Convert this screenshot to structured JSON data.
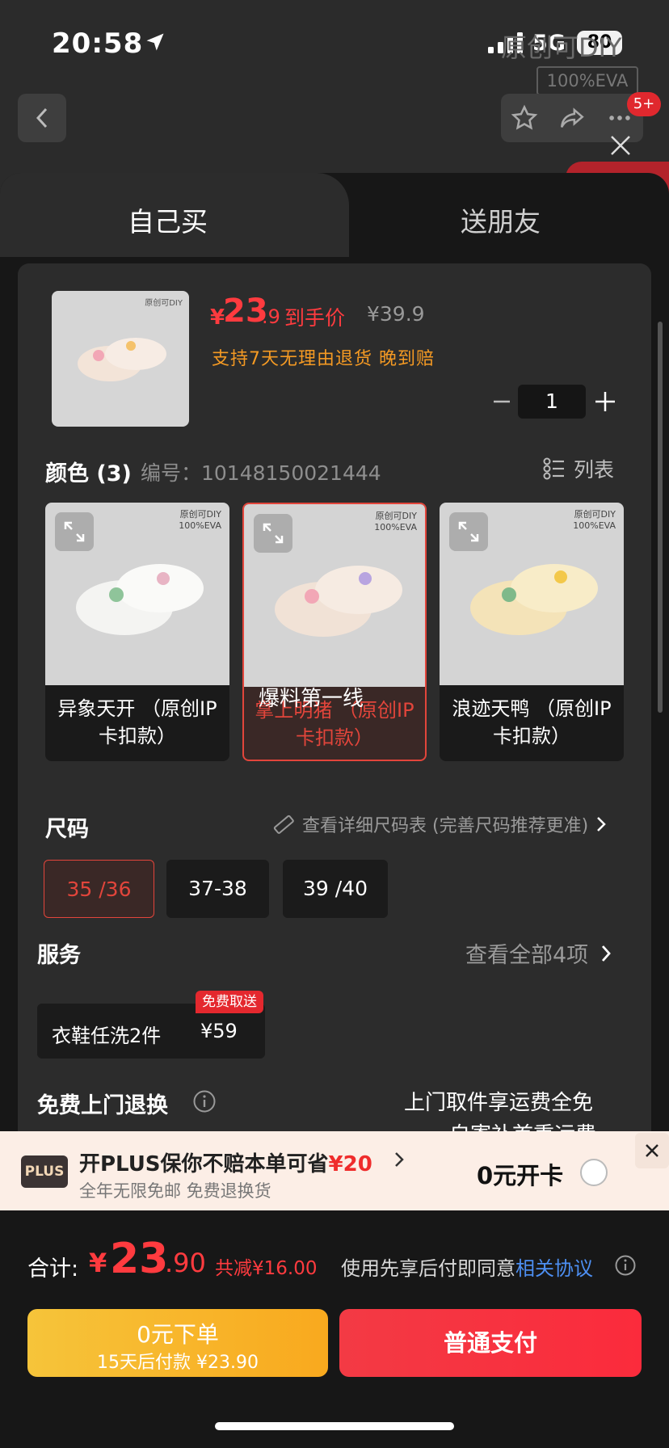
{
  "status": {
    "time": "20:58",
    "network": "5G",
    "battery": "80"
  },
  "background": {
    "title": "原创可DIY",
    "tag": "100%EVA",
    "cart_badge": "5+"
  },
  "tabs": [
    {
      "label": "自己买"
    },
    {
      "label": "送朋友"
    }
  ],
  "product": {
    "price_currency": "¥",
    "price_int": "23",
    "price_dec": ".9",
    "price_tag": "到手价",
    "price_old": "¥39.9",
    "promise": "支持7天无理由退货  晚到赔",
    "quantity": "1",
    "image_brand": "原创可DIY"
  },
  "color": {
    "title": "颜色 (3)",
    "sku": "编号：10148150021444",
    "list_label": "列表",
    "options": [
      {
        "label": "异象天开 （原创IP卡扣款）",
        "brand": "原创可DIY",
        "eva": "100%EVA"
      },
      {
        "label": "掌上明猪 （原创IP卡扣款）",
        "brand": "原创可DIY",
        "eva": "100%EVA"
      },
      {
        "label": "浪迹天鸭 （原创IP卡扣款）",
        "brand": "原创可DIY",
        "eva": "100%EVA"
      }
    ],
    "selected_index": 1,
    "watermark": "爆料第一线"
  },
  "size": {
    "title": "尺码",
    "chart_link": "查看详细尺码表 (完善尺码推荐更准)",
    "options": [
      {
        "label": "35 /36"
      },
      {
        "label": "37-38"
      },
      {
        "label": "39 /40"
      }
    ],
    "selected_index": 0
  },
  "service": {
    "title": "服务",
    "view_all": "查看全部4项",
    "item_name": "衣鞋任洗2件",
    "item_price": "¥59",
    "item_badge": "免费取送"
  },
  "return_service": {
    "title": "免费上门退换",
    "desc1": "上门取件享运费全免",
    "desc2": "自寄补首重运费"
  },
  "plus": {
    "logo": "PLUS",
    "line1_prefix": "开PLUS保你不赔本单可省",
    "line1_amount": "¥20",
    "line2": "全年无限免邮 免费退换货",
    "cta": "0元开卡"
  },
  "checkout": {
    "total_label": "合计:",
    "total_currency": "¥",
    "total_int": "23",
    "total_dec": ".90",
    "total_saved": "共减¥16.00",
    "agree_prefix": "使用先享后付即同意",
    "agree_link": "相关协议",
    "credit_line1": "0元下单",
    "credit_line2": "15天后付款 ¥23.90",
    "pay_label": "普通支付"
  },
  "colors": {
    "accent_red": "#ff3b3f",
    "promise_orange": "#f59a23",
    "link_blue": "#4d8ff2",
    "credit_yellow": "#f6c43a"
  }
}
